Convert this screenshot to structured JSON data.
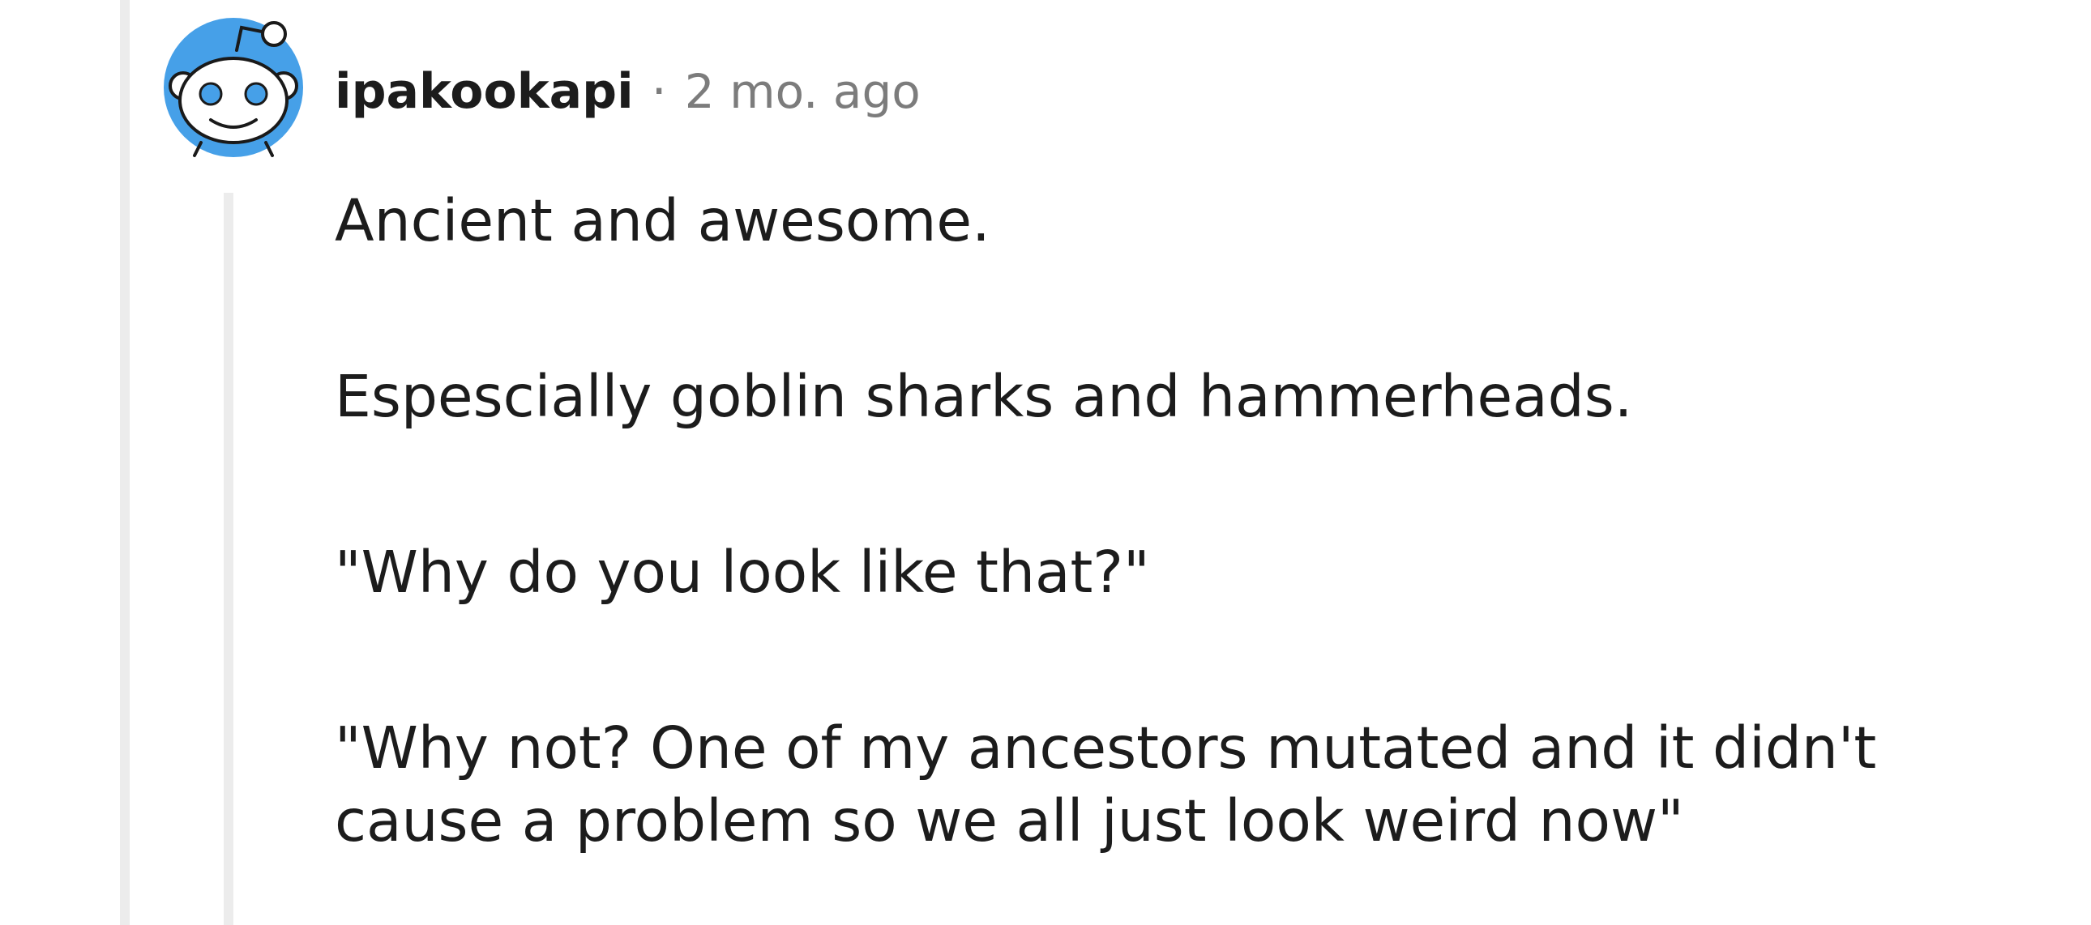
{
  "comment": {
    "author": "ipakookapi",
    "separator": "·",
    "timestamp": "2 mo. ago",
    "avatar_icon": "reddit-snoo-avatar-icon",
    "paragraphs": [
      "Ancient and awesome.",
      "Espescially goblin sharks and hammerheads.",
      "\"Why do you look like that?\"",
      "\"Why not? One of my ancestors mutated and it didn't cause a problem so we all just look weird now\""
    ]
  },
  "colors": {
    "avatar_blue": "#46a0e8",
    "text": "#1c1c1c",
    "meta": "#7c7c7c",
    "thread_line": "#ececec"
  }
}
